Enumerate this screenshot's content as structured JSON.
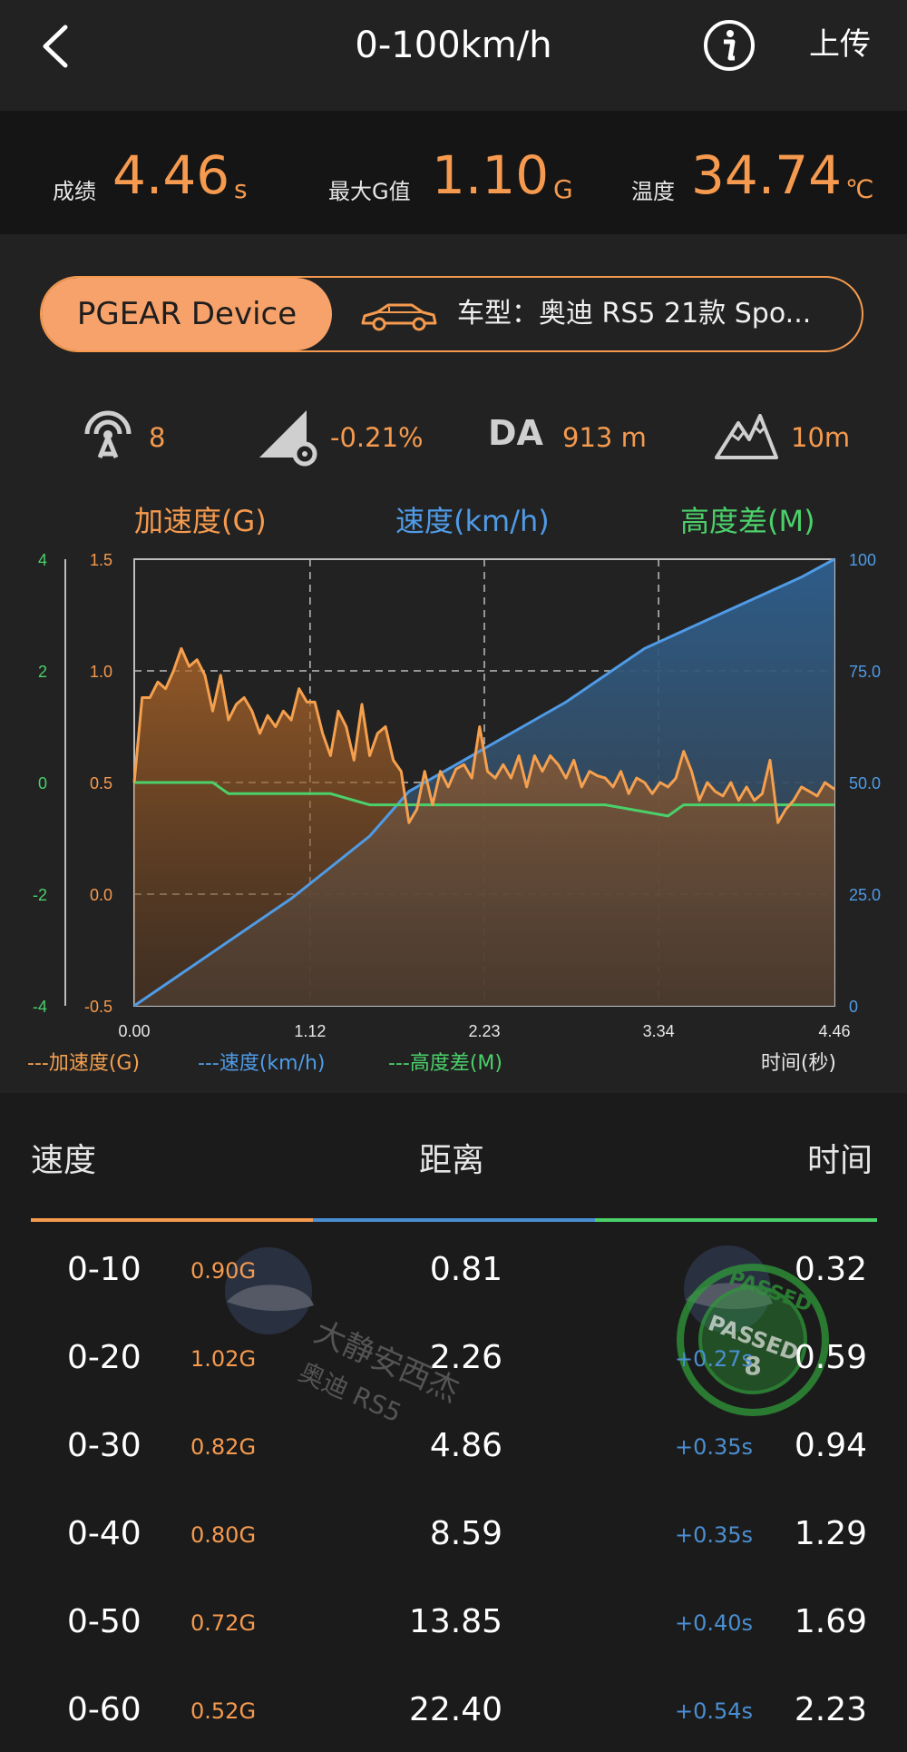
{
  "header": {
    "title": "0-100km/h",
    "upload_label": "上传"
  },
  "stats": {
    "result_label": "成绩",
    "result_value": "4.46",
    "result_unit": "s",
    "max_g_label": "最大G值",
    "max_g_value": "1.10",
    "max_g_unit": "G",
    "temp_label": "温度",
    "temp_value": "34.74",
    "temp_unit": "℃"
  },
  "device": {
    "name": "PGEAR Device",
    "car_model": "车型：奥迪 RS5 21款 Spo..."
  },
  "info_row": {
    "satellites": "8",
    "slope": "-0.21%",
    "da_label": "DA",
    "da_value": "913 m",
    "altitude": "10m"
  },
  "chart_data": {
    "type": "line",
    "axis_titles": {
      "left": "加速度(G)",
      "center": "速度(km/h)",
      "right": "高度差(M)"
    },
    "x": {
      "ticks": [
        "0.00",
        "1.12",
        "2.23",
        "3.34",
        "4.46"
      ],
      "range": [
        0,
        4.46
      ],
      "label": "时间(秒)"
    },
    "y_accel": {
      "ticks": [
        "1.5",
        "1.0",
        "0.5",
        "0.0",
        "-0.5"
      ],
      "range": [
        -0.5,
        1.5
      ]
    },
    "y_alt": {
      "ticks": [
        "4",
        "2",
        "0",
        "-2",
        "-4"
      ],
      "range": [
        -4,
        4
      ]
    },
    "y_speed": {
      "ticks": [
        "100",
        "75.0",
        "50.0",
        "25.0",
        "0"
      ],
      "range": [
        0,
        100
      ]
    },
    "legend": [
      "---加速度(G)",
      "---速度(km/h)",
      "---高度差(M)"
    ],
    "colors": {
      "accel": "#f5a04e",
      "speed": "#4f9be6",
      "alt": "#4bd06a"
    },
    "series": [
      {
        "name": "加速度(G)",
        "x": [
          0.0,
          0.05,
          0.1,
          0.15,
          0.2,
          0.25,
          0.3,
          0.35,
          0.4,
          0.45,
          0.5,
          0.55,
          0.6,
          0.65,
          0.7,
          0.75,
          0.8,
          0.85,
          0.9,
          0.95,
          1.0,
          1.05,
          1.1,
          1.15,
          1.2,
          1.25,
          1.3,
          1.35,
          1.4,
          1.45,
          1.5,
          1.55,
          1.6,
          1.65,
          1.7,
          1.75,
          1.8,
          1.85,
          1.9,
          1.95,
          2.0,
          2.05,
          2.1,
          2.15,
          2.2,
          2.25,
          2.3,
          2.35,
          2.4,
          2.45,
          2.5,
          2.55,
          2.6,
          2.65,
          2.7,
          2.75,
          2.8,
          2.85,
          2.9,
          2.95,
          3.0,
          3.05,
          3.1,
          3.15,
          3.2,
          3.25,
          3.3,
          3.35,
          3.4,
          3.45,
          3.5,
          3.55,
          3.6,
          3.65,
          3.7,
          3.75,
          3.8,
          3.85,
          3.9,
          3.95,
          4.0,
          4.05,
          4.1,
          4.15,
          4.2,
          4.25,
          4.3,
          4.35,
          4.4,
          4.46
        ],
        "values": [
          0.5,
          0.88,
          0.88,
          0.95,
          0.92,
          1.0,
          1.1,
          1.02,
          1.05,
          0.98,
          0.82,
          0.98,
          0.78,
          0.85,
          0.88,
          0.82,
          0.72,
          0.8,
          0.75,
          0.82,
          0.78,
          0.92,
          0.86,
          0.86,
          0.72,
          0.62,
          0.82,
          0.75,
          0.6,
          0.85,
          0.62,
          0.72,
          0.75,
          0.6,
          0.55,
          0.32,
          0.38,
          0.55,
          0.4,
          0.55,
          0.48,
          0.56,
          0.58,
          0.52,
          0.75,
          0.55,
          0.52,
          0.58,
          0.52,
          0.62,
          0.48,
          0.62,
          0.55,
          0.62,
          0.58,
          0.52,
          0.6,
          0.48,
          0.55,
          0.53,
          0.52,
          0.48,
          0.55,
          0.45,
          0.52,
          0.5,
          0.45,
          0.5,
          0.48,
          0.52,
          0.64,
          0.55,
          0.42,
          0.5,
          0.46,
          0.44,
          0.5,
          0.42,
          0.48,
          0.42,
          0.45,
          0.6,
          0.32,
          0.38,
          0.42,
          0.48,
          0.46,
          0.44,
          0.5,
          0.47
        ]
      },
      {
        "name": "速度(km/h)",
        "x": [
          0.0,
          0.25,
          0.5,
          0.75,
          1.0,
          1.25,
          1.5,
          1.75,
          2.0,
          2.25,
          2.5,
          2.75,
          3.0,
          3.25,
          3.5,
          3.75,
          4.0,
          4.25,
          4.46
        ],
        "values": [
          0,
          6,
          12,
          18,
          24,
          31,
          38,
          48,
          53,
          58,
          63,
          68,
          74,
          80,
          84,
          88,
          92,
          96,
          100
        ]
      },
      {
        "name": "高度差(M)",
        "x": [
          0.0,
          0.5,
          0.6,
          1.2,
          1.25,
          1.5,
          3.0,
          3.4,
          3.5,
          4.46
        ],
        "values": [
          0.0,
          0.0,
          -0.2,
          -0.2,
          -0.2,
          -0.4,
          -0.4,
          -0.6,
          -0.4,
          -0.4
        ]
      }
    ]
  },
  "table": {
    "headers": {
      "speed": "速度",
      "distance": "距离",
      "time": "时间"
    },
    "rows": [
      {
        "range": "0-10",
        "g": "0.90G",
        "distance": "0.81",
        "diff": "",
        "time": "0.32"
      },
      {
        "range": "0-20",
        "g": "1.02G",
        "distance": "2.26",
        "diff": "+0.27s",
        "time": "0.59"
      },
      {
        "range": "0-30",
        "g": "0.82G",
        "distance": "4.86",
        "diff": "+0.35s",
        "time": "0.94"
      },
      {
        "range": "0-40",
        "g": "0.80G",
        "distance": "8.59",
        "diff": "+0.35s",
        "time": "1.29"
      },
      {
        "range": "0-50",
        "g": "0.72G",
        "distance": "13.85",
        "diff": "+0.40s",
        "time": "1.69"
      },
      {
        "range": "0-60",
        "g": "0.52G",
        "distance": "22.40",
        "diff": "+0.54s",
        "time": "2.23"
      }
    ]
  },
  "watermark": {
    "line1": "大静安西杰",
    "line2": "奥迪 RS5",
    "stamp_text": "PASSED",
    "stamp_number": "8"
  }
}
